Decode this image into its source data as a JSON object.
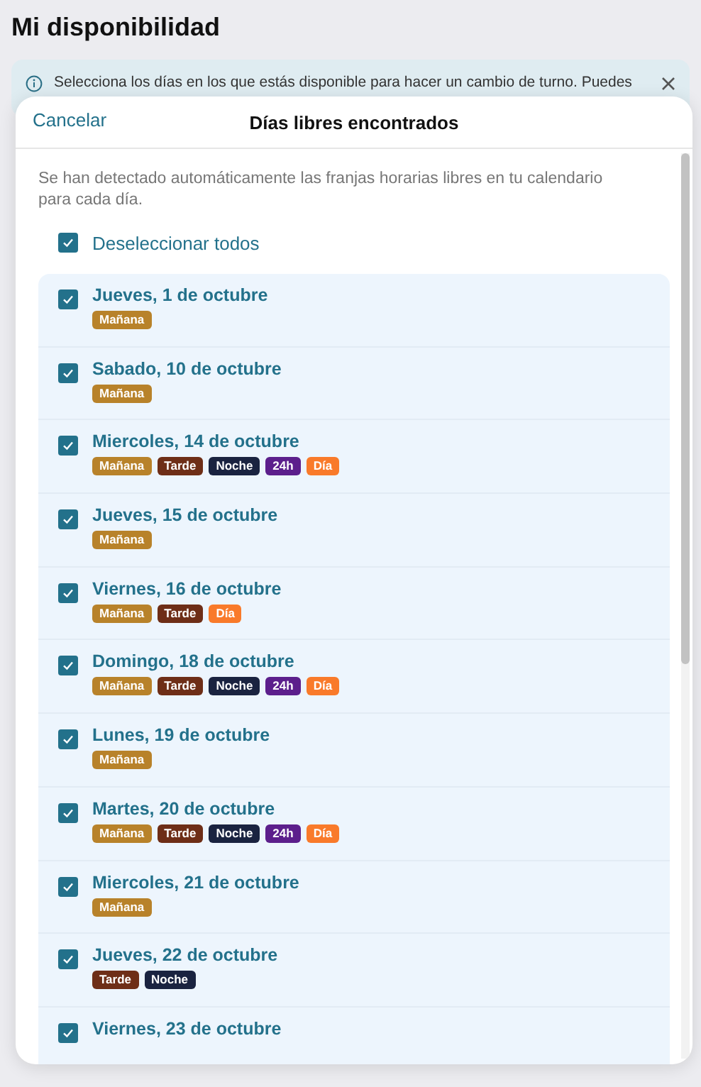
{
  "page": {
    "title": "Mi disponibilidad",
    "info_banner": "Selecciona los días en los que estás disponible para hacer un cambio de turno. Puedes"
  },
  "modal": {
    "cancel": "Cancelar",
    "title": "Días libres encontrados",
    "description": "Se han detectado automáticamente las franjas horarias libres en tu calendario para cada día.",
    "select_all": {
      "label": "Deseleccionar todos",
      "checked": true
    },
    "days": [
      {
        "label": "Jueves, 1 de octubre",
        "checked": true,
        "tags": [
          {
            "text": "Mañana",
            "color": "#b8822a"
          }
        ]
      },
      {
        "label": "Sabado, 10 de octubre",
        "checked": true,
        "tags": [
          {
            "text": "Mañana",
            "color": "#b8822a"
          }
        ]
      },
      {
        "label": "Miercoles, 14 de octubre",
        "checked": true,
        "tags": [
          {
            "text": "Mañana",
            "color": "#b8822a"
          },
          {
            "text": "Tarde",
            "color": "#6e2e17"
          },
          {
            "text": "Noche",
            "color": "#1a2340"
          },
          {
            "text": "24h",
            "color": "#5c1f8c"
          },
          {
            "text": "Día",
            "color": "#f97a2a"
          }
        ]
      },
      {
        "label": "Jueves, 15 de octubre",
        "checked": true,
        "tags": [
          {
            "text": "Mañana",
            "color": "#b8822a"
          }
        ]
      },
      {
        "label": "Viernes, 16 de octubre",
        "checked": true,
        "tags": [
          {
            "text": "Mañana",
            "color": "#b8822a"
          },
          {
            "text": "Tarde",
            "color": "#6e2e17"
          },
          {
            "text": "Día",
            "color": "#f97a2a"
          }
        ]
      },
      {
        "label": "Domingo, 18 de octubre",
        "checked": true,
        "tags": [
          {
            "text": "Mañana",
            "color": "#b8822a"
          },
          {
            "text": "Tarde",
            "color": "#6e2e17"
          },
          {
            "text": "Noche",
            "color": "#1a2340"
          },
          {
            "text": "24h",
            "color": "#5c1f8c"
          },
          {
            "text": "Día",
            "color": "#f97a2a"
          }
        ]
      },
      {
        "label": "Lunes, 19 de octubre",
        "checked": true,
        "tags": [
          {
            "text": "Mañana",
            "color": "#b8822a"
          }
        ]
      },
      {
        "label": "Martes, 20 de octubre",
        "checked": true,
        "tags": [
          {
            "text": "Mañana",
            "color": "#b8822a"
          },
          {
            "text": "Tarde",
            "color": "#6e2e17"
          },
          {
            "text": "Noche",
            "color": "#1a2340"
          },
          {
            "text": "24h",
            "color": "#5c1f8c"
          },
          {
            "text": "Día",
            "color": "#f97a2a"
          }
        ]
      },
      {
        "label": "Miercoles, 21 de octubre",
        "checked": true,
        "tags": [
          {
            "text": "Mañana",
            "color": "#b8822a"
          }
        ]
      },
      {
        "label": "Jueves, 22 de octubre",
        "checked": true,
        "tags": [
          {
            "text": "Tarde",
            "color": "#6e2e17"
          },
          {
            "text": "Noche",
            "color": "#1a2340"
          }
        ]
      },
      {
        "label": "Viernes, 23 de octubre",
        "checked": true
      }
    ]
  }
}
